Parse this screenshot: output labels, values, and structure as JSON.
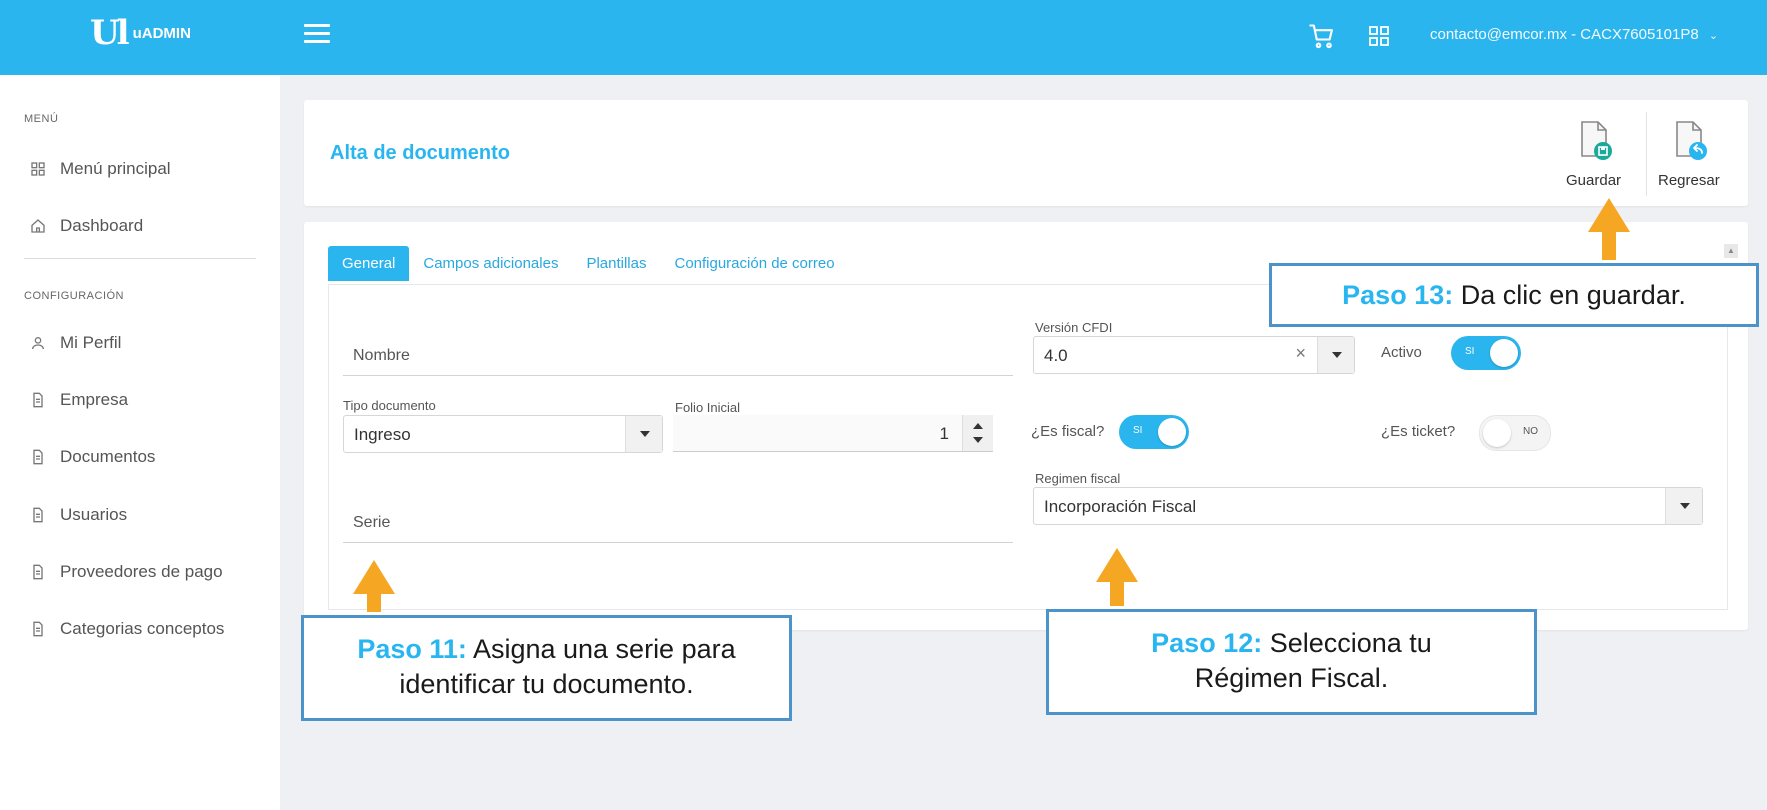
{
  "topbar": {
    "logo_mark": "Ul",
    "logo_text": "uADMIN",
    "user": "contacto@emcor.mx - CACX7605101P8",
    "cart_icon": "cart-icon",
    "apps_icon": "grid-icon"
  },
  "sidebar": {
    "section_menu": "MENÚ",
    "section_config": "CONFIGURACIÓN",
    "items": [
      {
        "label": "Menú principal",
        "icon": "grid-icon"
      },
      {
        "label": "Dashboard",
        "icon": "home-icon"
      },
      {
        "label": "Mi Perfil",
        "icon": "user-icon"
      },
      {
        "label": "Empresa",
        "icon": "document-icon"
      },
      {
        "label": "Documentos",
        "icon": "document-icon"
      },
      {
        "label": "Usuarios",
        "icon": "document-icon"
      },
      {
        "label": "Proveedores de pago",
        "icon": "document-icon"
      },
      {
        "label": "Categorias conceptos",
        "icon": "document-icon"
      }
    ]
  },
  "header": {
    "title": "Alta de documento",
    "save_label": "Guardar",
    "back_label": "Regresar"
  },
  "tabs": [
    "General",
    "Campos adicionales",
    "Plantillas",
    "Configuración de correo"
  ],
  "form": {
    "nombre_placeholder": "Nombre",
    "version_label": "Versión CFDI",
    "version_value": "4.0",
    "activo_label": "Activo",
    "activo_state": "SI",
    "tipo_label": "Tipo documento",
    "tipo_value": "Ingreso",
    "folio_label": "Folio Inicial",
    "folio_value": "1",
    "fiscal_label": "¿Es fiscal?",
    "fiscal_state": "SI",
    "ticket_label": "¿Es ticket?",
    "ticket_state": "NO",
    "serie_placeholder": "Serie",
    "regimen_label": "Regimen fiscal",
    "regimen_value": "Incorporación Fiscal"
  },
  "callouts": {
    "c11_step": "Paso 11:",
    "c11_text_1": " Asigna una serie para",
    "c11_text_2": "identificar tu documento.",
    "c12_step": "Paso 12:",
    "c12_text_1": " Selecciona tu",
    "c12_text_2": "Régimen Fiscal.",
    "c13_step": "Paso 13:",
    "c13_text": " Da clic en guardar."
  },
  "colors": {
    "primary": "#2bb5ee",
    "arrow": "#f5a623",
    "callout_border": "#4b93c9"
  }
}
